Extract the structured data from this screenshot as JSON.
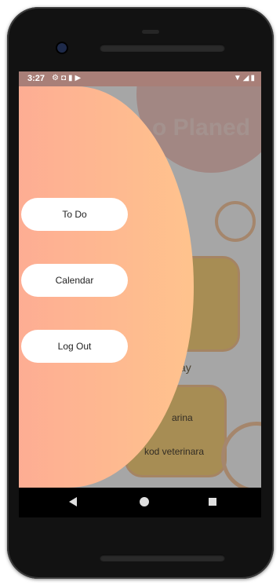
{
  "status_bar": {
    "time": "3:27",
    "left_icons": [
      "gear-icon",
      "square-icon",
      "sd-card-icon",
      "play-icon"
    ],
    "right_icons": [
      "wifi-icon",
      "signal-icon",
      "battery-icon"
    ]
  },
  "background": {
    "title": "o Planed",
    "day_label": "ay",
    "item_1": "arina",
    "item_2": "kod veterinara"
  },
  "drawer": {
    "gradient": [
      "#fdab94",
      "#ffc38d"
    ],
    "items": [
      {
        "label": "To Do"
      },
      {
        "label": "Calendar"
      },
      {
        "label": "Log Out"
      }
    ]
  },
  "nav_bar": {
    "icons": [
      "back-icon",
      "home-icon",
      "recents-icon"
    ]
  }
}
